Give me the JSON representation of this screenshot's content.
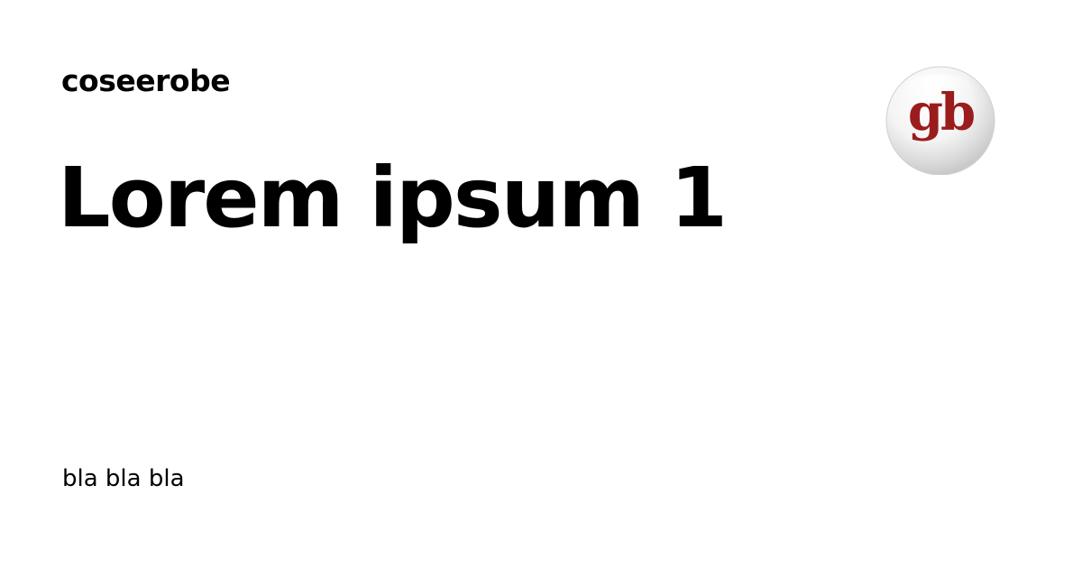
{
  "site": {
    "name": "coseerobe",
    "logo_text": "gb"
  },
  "post": {
    "title": "Lorem ipsum 1",
    "excerpt": "bla bla bla"
  },
  "colors": {
    "background": "#ffffff",
    "text": "#000000",
    "logo_letters": "#9b1c1c"
  },
  "icons": {
    "logo": "gb-logo-icon"
  }
}
